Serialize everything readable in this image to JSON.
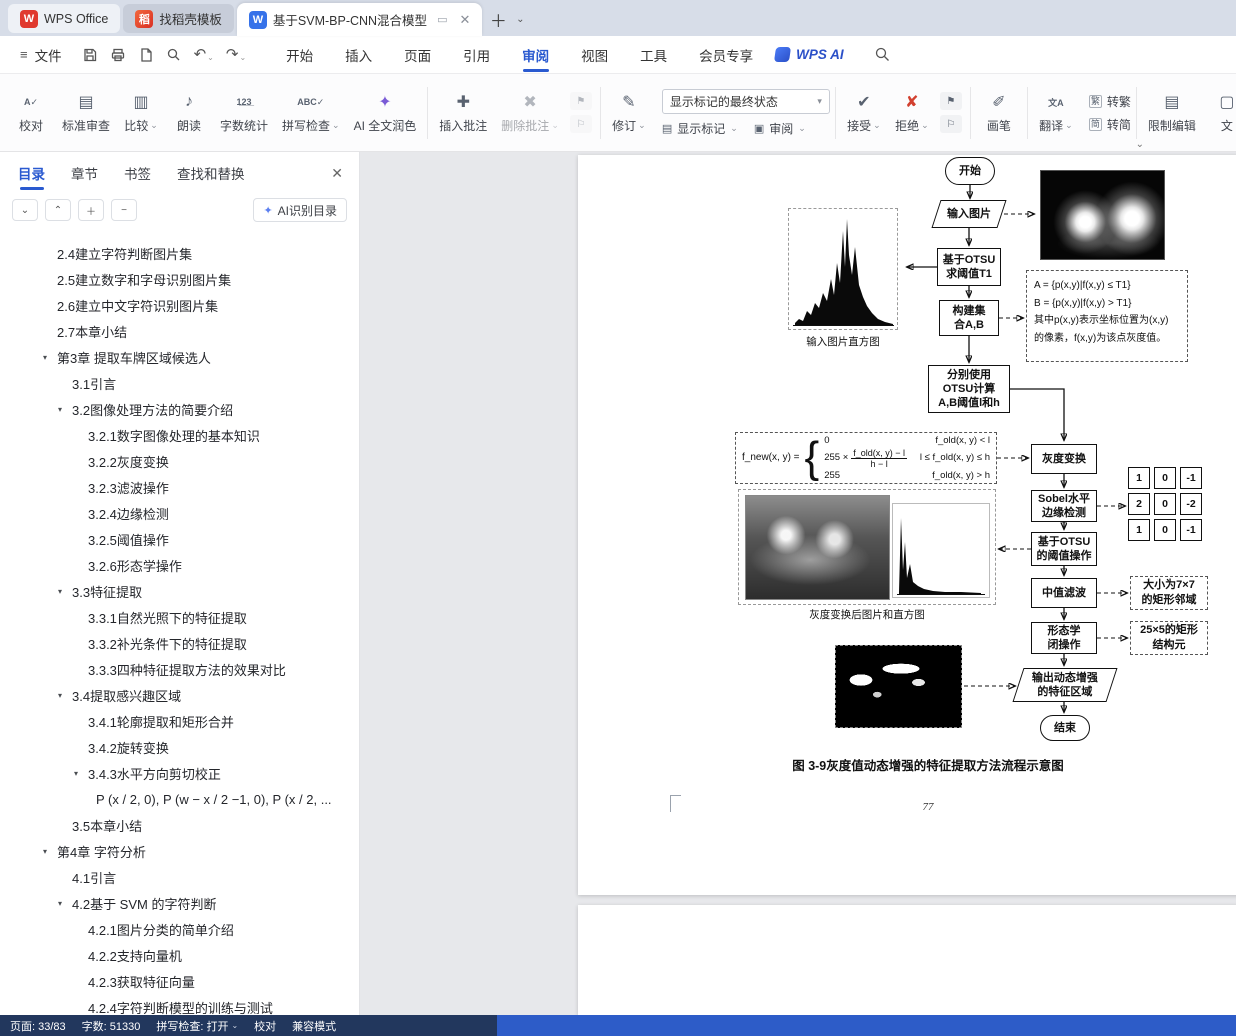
{
  "window": {
    "home_tab": "WPS Office",
    "template_tab": "找稻壳模板",
    "doc_tab": "基于SVM-BP-CNN混合模型"
  },
  "menubar": {
    "file": "文件",
    "tabs": [
      {
        "label": "开始"
      },
      {
        "label": "插入"
      },
      {
        "label": "页面"
      },
      {
        "label": "引用"
      },
      {
        "label": "审阅",
        "active": true
      },
      {
        "label": "视图"
      },
      {
        "label": "工具"
      },
      {
        "label": "会员专享"
      }
    ],
    "wps_ai": "WPS AI"
  },
  "ribbon": {
    "proof": "校对",
    "std_review": "标准审查",
    "compare": "比较",
    "read_aloud": "朗读",
    "word_count": "字数统计",
    "spell_check": "拼写检查",
    "ai_polish": "AI 全文润色",
    "insert_comment": "插入批注",
    "delete_comment": "删除批注",
    "revise": "修订",
    "markup_state": "显示标记的最终状态",
    "show_markup": "显示标记",
    "review": "审阅",
    "accept": "接受",
    "reject": "拒绝",
    "pen": "画笔",
    "translate": "翻译",
    "to_traditional": "转繁",
    "to_simplified": "转简",
    "restrict_edit": "限制编辑",
    "clipped": "文"
  },
  "sidebar": {
    "tabs": [
      {
        "label": "目录",
        "active": true
      },
      {
        "label": "章节"
      },
      {
        "label": "书签"
      },
      {
        "label": "查找和替换"
      }
    ],
    "ai_recognize": "AI识别目录",
    "toc": [
      {
        "label": "2.4建立字符判断图片集",
        "indent": 57,
        "tri": false
      },
      {
        "label": "2.5建立数字和字母识别图片集",
        "indent": 57,
        "tri": false
      },
      {
        "label": "2.6建立中文字符识别图片集",
        "indent": 57,
        "tri": false
      },
      {
        "label": "2.7本章小结",
        "indent": 57,
        "tri": false
      },
      {
        "label": "第3章 提取车牌区域候选人",
        "indent": 57,
        "tri": true
      },
      {
        "label": "3.1引言",
        "indent": 72,
        "tri": false
      },
      {
        "label": "3.2图像处理方法的简要介绍",
        "indent": 72,
        "tri": true
      },
      {
        "label": "3.2.1数字图像处理的基本知识",
        "indent": 88,
        "tri": false
      },
      {
        "label": "3.2.2灰度变换",
        "indent": 88,
        "tri": false
      },
      {
        "label": "3.2.3滤波操作",
        "indent": 88,
        "tri": false
      },
      {
        "label": "3.2.4边缘检测",
        "indent": 88,
        "tri": false
      },
      {
        "label": "3.2.5阈值操作",
        "indent": 88,
        "tri": false
      },
      {
        "label": "3.2.6形态学操作",
        "indent": 88,
        "tri": false
      },
      {
        "label": "3.3特征提取",
        "indent": 72,
        "tri": true
      },
      {
        "label": "3.3.1自然光照下的特征提取",
        "indent": 88,
        "tri": false
      },
      {
        "label": "3.3.2补光条件下的特征提取",
        "indent": 88,
        "tri": false
      },
      {
        "label": "3.3.3四种特征提取方法的效果对比",
        "indent": 88,
        "tri": false
      },
      {
        "label": "3.4提取感兴趣区域",
        "indent": 72,
        "tri": true
      },
      {
        "label": "3.4.1轮廓提取和矩形合并",
        "indent": 88,
        "tri": false
      },
      {
        "label": "3.4.2旋转变换",
        "indent": 88,
        "tri": false
      },
      {
        "label": "3.4.3水平方向剪切校正",
        "indent": 88,
        "tri": true
      },
      {
        "label": "P (x / 2, 0), P (w − x / 2 −1, 0), P (x / 2, ...",
        "indent": 96,
        "tri": false
      },
      {
        "label": "3.5本章小结",
        "indent": 72,
        "tri": false
      },
      {
        "label": "第4章 字符分析",
        "indent": 57,
        "tri": true
      },
      {
        "label": "4.1引言",
        "indent": 72,
        "tri": false
      },
      {
        "label": "4.2基于 SVM 的字符判断",
        "indent": 72,
        "tri": true
      },
      {
        "label": "4.2.1图片分类的简单介绍",
        "indent": 88,
        "tri": false
      },
      {
        "label": "4.2.2支持向量机",
        "indent": 88,
        "tri": false
      },
      {
        "label": "4.2.3获取特征向量",
        "indent": 88,
        "tri": false
      },
      {
        "label": "4.2.4字符判断模型的训练与测试",
        "indent": 88,
        "tri": false
      }
    ]
  },
  "doc": {
    "flowchart": {
      "start": "开始",
      "input": "输入图片",
      "otsu_t1": [
        "基于OTSU",
        "求阈值T1"
      ],
      "hist1_label": "输入图片直方图",
      "build": [
        "构建集",
        "合A,B"
      ],
      "note": [
        "A = {p(x,y)|f(x,y) ≤ T1}",
        "B = {p(x,y)|f(x,y) > T1}",
        "其中p(x,y)表示坐标位置为(x,y)",
        "的像素，f(x,y)为该点灰度值。"
      ],
      "otsu_lh": [
        "分别使用",
        "OTSU计算",
        "A,B阈值l和h"
      ],
      "formula": {
        "lhs": "f_new(x, y) =",
        "c1": "0",
        "c1cond": "f_old(x, y) < l",
        "c2pre": "255 ×",
        "c2num": "f_old(x, y) − l",
        "c2den": "h − l",
        "c2cond": "l ≤ f_old(x, y) ≤ h",
        "c3": "255",
        "c3cond": "f_old(x, y) > h"
      },
      "gray": "灰度变换",
      "sobel": [
        "Sobel水平",
        "边缘检测"
      ],
      "kernel": [
        [
          "1",
          "0",
          "-1"
        ],
        [
          "2",
          "0",
          "-2"
        ],
        [
          "1",
          "0",
          "-1"
        ]
      ],
      "otsu_th": [
        "基于OTSU",
        "的阈值操作"
      ],
      "gray_label": "灰度变换后图片和直方图",
      "median": "中值滤波",
      "median_note": [
        "大小为7×7",
        "的矩形邻域"
      ],
      "morph": [
        "形态学",
        "闭操作"
      ],
      "morph_note": [
        "25×5的矩形",
        "结构元"
      ],
      "output": [
        "输出动态增强",
        "的特征区域"
      ],
      "end": "结束"
    },
    "caption": "图 3-9灰度值动态增强的特征提取方法流程示意图",
    "page_number": "77"
  },
  "statusbar": {
    "page": "页面: 33/83",
    "words": "字数: 51330",
    "spell": "拼写检查: 打开",
    "proof": "校对",
    "mode": "兼容模式"
  }
}
